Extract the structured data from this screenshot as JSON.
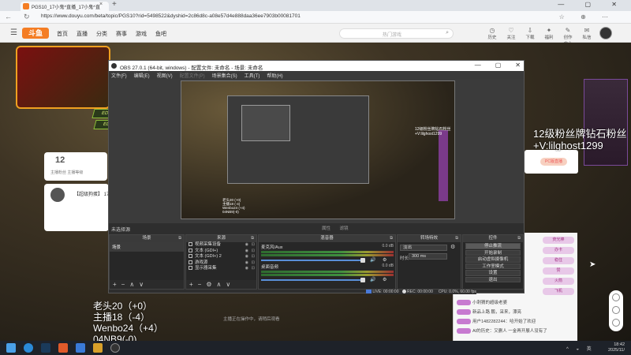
{
  "browser": {
    "tab_title": "PGS10_17小鬼^直播_17小鬼^直",
    "tab_close": "×",
    "new_tab": "+",
    "url": "https://www.douyu.com/beta/topic/PGS10?rid=5498522&dyshid=2c86d8c-a08e57d4e888daa36ee7903b00081701",
    "nav_back": "←",
    "nav_refresh": "↻",
    "window_controls": "—  ▢  ✕"
  },
  "site": {
    "logo": "斗鱼",
    "nav": [
      "首页",
      "直播",
      "分类",
      "赛事",
      "游戏",
      "鱼吧"
    ],
    "search_placeholder": "热门游戏",
    "header_icons": [
      {
        "icon": "history-icon",
        "label": "历史"
      },
      {
        "icon": "follow-icon",
        "label": "关注"
      },
      {
        "icon": "download-icon",
        "label": "下载"
      },
      {
        "icon": "gift-icon",
        "label": "福利"
      },
      {
        "icon": "creator-icon",
        "label": "创作中心"
      },
      {
        "icon": "message-icon",
        "label": "私信"
      }
    ]
  },
  "page": {
    "info_number": "12",
    "info_label": "主播粉丝    主播等级",
    "streamer_name": "【超级狗蛋】 17小鬼^",
    "side_pills": [
      "ED",
      "ED"
    ],
    "right_card_label": "PC版直播"
  },
  "overlay": {
    "right_text": "12级粉丝牌钻石粉丝\n+V:lilghost1299",
    "scores": [
      "老头20（+0）",
      "主播18（-4）",
      "Wenbo24（+4）",
      "04NB9(-0)"
    ],
    "below_text": "主播正在操作中，请稍后观看"
  },
  "chat": {
    "rows": [
      "小刺猬的超级老婆",
      "新品上路  鹏，采来，漂亮",
      "用户1482282244：哈开始了欢迎",
      "AI的历史：又删人  一金再开展人没有了"
    ],
    "gifts": [
      "荧光棒",
      "办卡",
      "稳住",
      "赞",
      "火箭",
      "飞机"
    ]
  },
  "obs": {
    "title": "OBS 27.0.1 (64-bit, windows) - 配置文件: 未命名 - 场景: 未命名",
    "menu": [
      "文件(F)",
      "编辑(E)",
      "视图(V)",
      "配置文件(P)",
      "场景集合(S)",
      "工具(T)",
      "帮助(H)"
    ],
    "window_controls": [
      "—",
      "▢",
      "✕"
    ],
    "preview_overlay": "12级粉丝牌钻石粉丝\n+V:lilghost1299",
    "preview_scores": "老头20 (+0)\n主播18 (-4)\nWenbo24 (+4)\n04NB9(-0)",
    "source_label": "未选择源",
    "mini_buttons": [
      "属性",
      "滤镜"
    ],
    "docks": {
      "scenes": "场景",
      "sources": "来源",
      "mixer": "混音器",
      "transitions": "转场特效",
      "controls": "控件"
    },
    "scenes": [
      "场景"
    ],
    "sources": [
      {
        "icon": "camera-icon",
        "label": "视频采集设备"
      },
      {
        "icon": "text-icon",
        "label": "文本 (GDI+)"
      },
      {
        "icon": "text-icon",
        "label": "文本 (GDI+) 2"
      },
      {
        "icon": "game-icon",
        "label": "游戏源"
      },
      {
        "icon": "monitor-icon",
        "label": "显示器采集"
      }
    ],
    "mixer": [
      {
        "name": "麦克风/Aux",
        "db": "0.0 dB"
      },
      {
        "name": "桌面音频",
        "db": "0.0 dB"
      }
    ],
    "transition": {
      "type": "淡出",
      "duration_label": "时长",
      "duration": "300 ms"
    },
    "controls": [
      "停止推流",
      "开始录制",
      "启动虚拟摄像机",
      "工作室模式",
      "设置",
      "退出"
    ],
    "status": {
      "live": "LIVE: 00:00:00",
      "rec": "REC: 00:00:00",
      "cpu": "CPU: 0.0%, 60.00 fps"
    }
  },
  "taskbar": {
    "time": "18:42",
    "date": "2025/11/",
    "lang": "英"
  },
  "colors": {
    "accent": "#f47d24",
    "obs_bg": "#2e2e2e",
    "meter_green": "#3f8f3f",
    "fader_blue": "#5a8fd8"
  }
}
